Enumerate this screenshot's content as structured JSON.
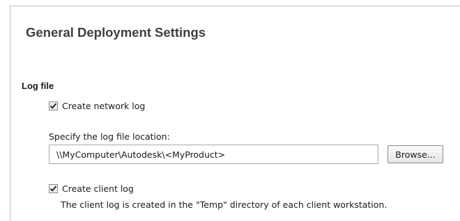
{
  "page": {
    "title": "General Deployment Settings"
  },
  "log_file_section": {
    "heading": "Log file",
    "network_log": {
      "label": "Create network log",
      "checked": true
    },
    "location_label": "Specify the log file location:",
    "location_value": "\\\\MyComputer\\Autodesk\\<MyProduct>",
    "browse_label": "Browse...",
    "client_log": {
      "label": "Create client log",
      "checked": true,
      "description": "The client log is created in the \"Temp\" directory of each client workstation."
    }
  },
  "icons": {
    "checkmark": "check-icon"
  },
  "colors": {
    "title": "#3f3f3f",
    "panel_border": "#bdbdbd",
    "input_border": "#a9a9a9"
  }
}
